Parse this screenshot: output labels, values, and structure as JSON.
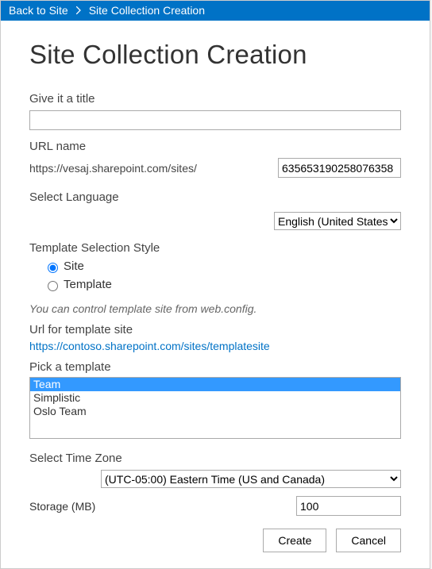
{
  "breadcrumb": {
    "back_label": "Back to Site",
    "current": "Site Collection Creation"
  },
  "page_heading": "Site Collection Creation",
  "fields": {
    "title_label": "Give it a title",
    "title_value": "",
    "url_label": "URL name",
    "url_base": "https://vesaj.sharepoint.com/sites/",
    "url_id_value": "635653190258076358",
    "language_label": "Select Language",
    "language_selected": "English (United States)",
    "template_style_label": "Template Selection Style",
    "template_style_options": {
      "site": "Site",
      "template": "Template"
    },
    "template_style_selected": "site",
    "template_hint": "You can control template site from web.config.",
    "template_url_label": "Url for template site",
    "template_url": "https://contoso.sharepoint.com/sites/templatesite",
    "pick_template_label": "Pick a template",
    "templates": [
      "Team",
      "Simplistic",
      "Oslo Team"
    ],
    "template_selected_index": 0,
    "timezone_label": "Select Time Zone",
    "timezone_selected": "(UTC-05:00) Eastern Time (US and Canada)",
    "storage_label": "Storage (MB)",
    "storage_value": "100"
  },
  "buttons": {
    "create": "Create",
    "cancel": "Cancel"
  }
}
